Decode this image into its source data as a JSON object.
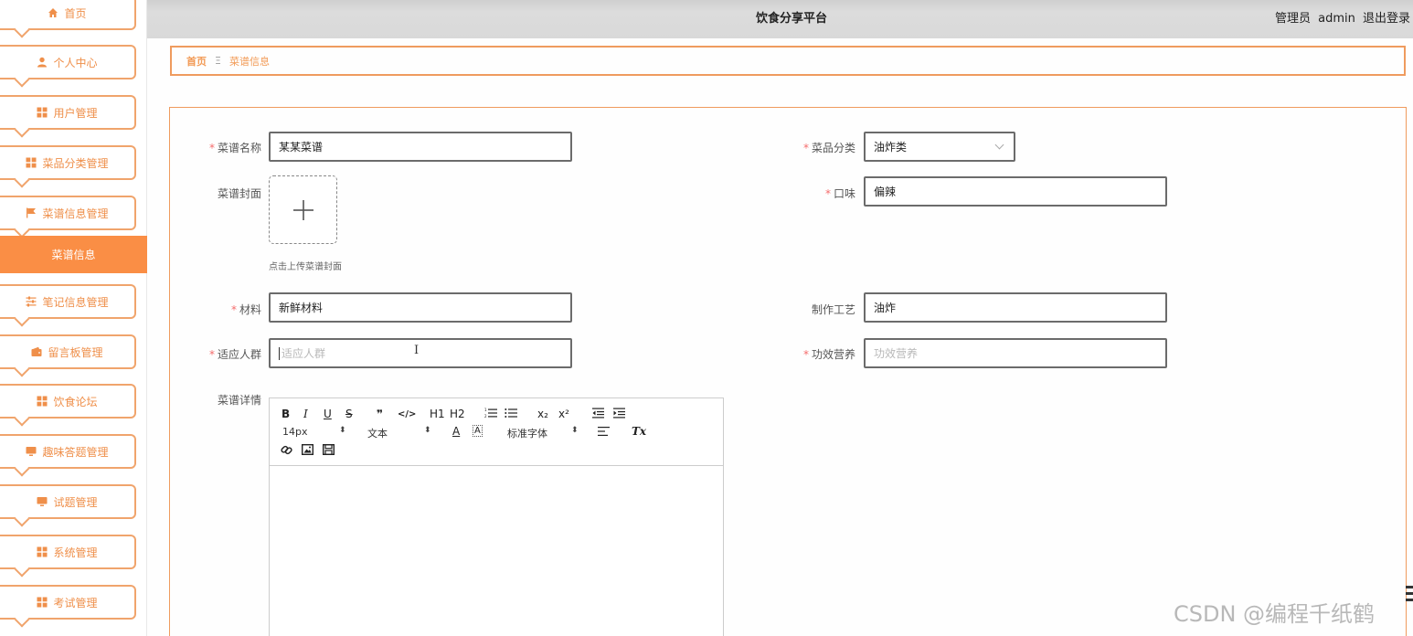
{
  "sidebar": {
    "items": [
      {
        "label": "首页",
        "icon": "home-icon"
      },
      {
        "label": "个人中心",
        "icon": "user-icon"
      },
      {
        "label": "用户管理",
        "icon": "grid-icon"
      },
      {
        "label": "菜品分类管理",
        "icon": "grid-icon"
      },
      {
        "label": "菜谱信息管理",
        "icon": "flag-icon"
      },
      {
        "label": "菜谱信息",
        "active": true
      },
      {
        "label": "笔记信息管理",
        "icon": "sliders-icon"
      },
      {
        "label": "留言板管理",
        "icon": "wallet-icon"
      },
      {
        "label": "饮食论坛",
        "icon": "grid-icon"
      },
      {
        "label": "趣味答题管理",
        "icon": "monitor-icon"
      },
      {
        "label": "试题管理",
        "icon": "monitor-icon"
      },
      {
        "label": "系统管理",
        "icon": "grid-icon"
      },
      {
        "label": "考试管理",
        "icon": "grid-icon"
      }
    ]
  },
  "header": {
    "title": "饮食分享平台",
    "role": "管理员",
    "username": "admin",
    "logout": "退出登录"
  },
  "breadcrumb": {
    "home": "首页",
    "separator": "Ξ",
    "current": "菜谱信息"
  },
  "form": {
    "recipe_name": {
      "label": "菜谱名称",
      "value": "某某菜谱",
      "required": true
    },
    "category": {
      "label": "菜品分类",
      "value": "油炸类",
      "required": true
    },
    "cover": {
      "label": "菜谱封面",
      "hint": "点击上传菜谱封面"
    },
    "taste": {
      "label": "口味",
      "value": "偏辣",
      "required": true
    },
    "ingredients": {
      "label": "材料",
      "value": "新鲜材料",
      "required": true
    },
    "technique": {
      "label": "制作工艺",
      "value": "油炸"
    },
    "audience": {
      "label": "适应人群",
      "placeholder": "适应人群",
      "value": "",
      "required": true
    },
    "nutrition": {
      "label": "功效营养",
      "placeholder": "功效营养",
      "value": "",
      "required": true
    },
    "details": {
      "label": "菜谱详情"
    }
  },
  "editor": {
    "font_size": "14px",
    "header_select": "文本",
    "font_family": "标准字体",
    "buttons": [
      "B",
      "I",
      "U",
      "S",
      "❞",
      "</>",
      "H1",
      "H2",
      "ordered-list",
      "bullet-list",
      "x₂",
      "x²",
      "outdent",
      "indent",
      "A",
      "A",
      "align",
      "Tx",
      "link",
      "image",
      "video"
    ]
  },
  "watermark": "CSDN @编程千纸鹤",
  "colors": {
    "accent": "#fa8e45",
    "border_accent": "#ef9b5e",
    "required": "#f56c6c"
  }
}
